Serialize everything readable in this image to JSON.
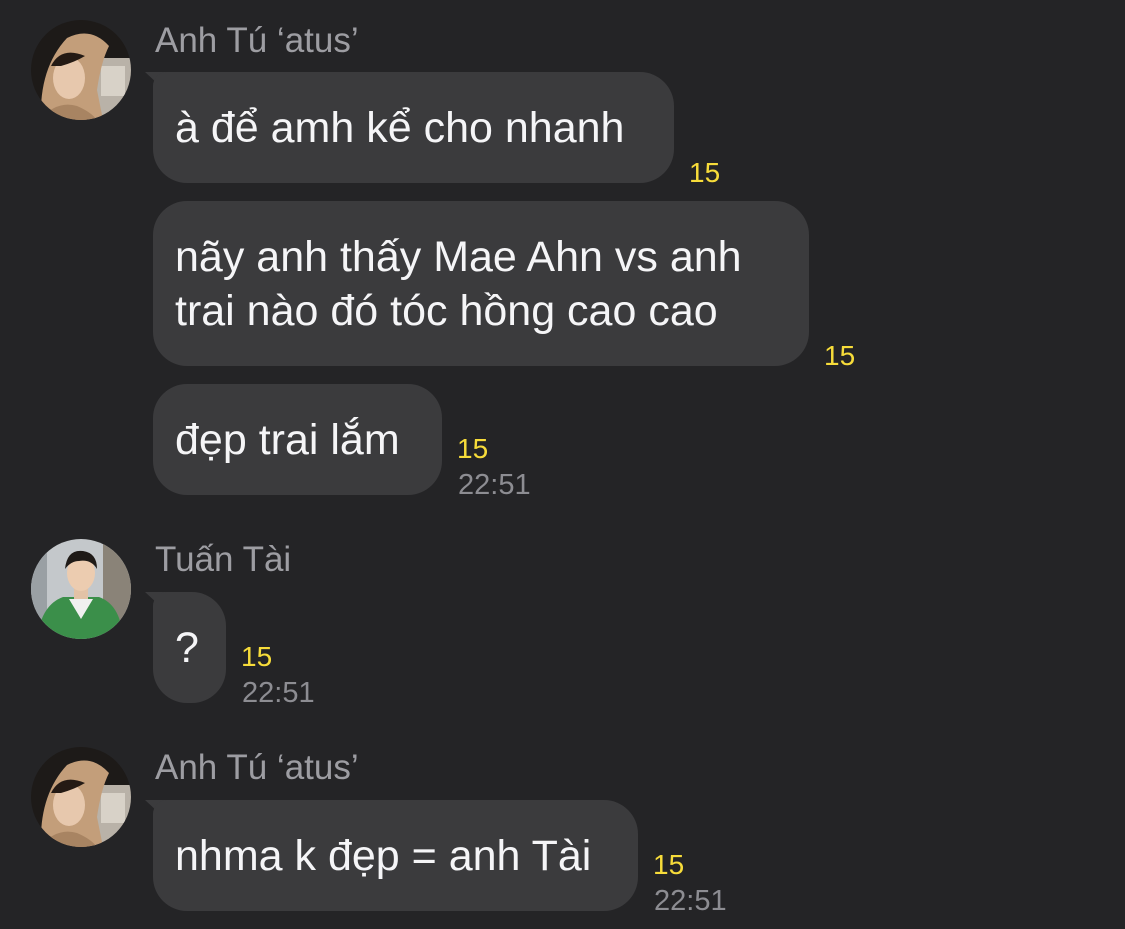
{
  "groups": [
    {
      "sender": "Anh Tú ‘atus’",
      "avatar": "avatar-anh-tu",
      "messages": [
        {
          "text": "à để amh kể cho nhanh",
          "reaction": "15"
        },
        {
          "lines": [
            "nãy anh thấy Mae Ahn vs anh",
            "trai nào đó tóc hồng cao cao"
          ],
          "reaction": "15"
        },
        {
          "text": "đẹp trai lắm",
          "reaction": "15",
          "time": "22:51"
        }
      ]
    },
    {
      "sender": "Tuấn Tài",
      "avatar": "avatar-tuan-tai",
      "messages": [
        {
          "text": "?",
          "reaction": "15",
          "time": "22:51"
        }
      ]
    },
    {
      "sender": "Anh Tú ‘atus’",
      "avatar": "avatar-anh-tu",
      "messages": [
        {
          "text": "nhma k đẹp = anh Tài",
          "reaction": "15",
          "time": "22:51"
        }
      ]
    }
  ],
  "colors": {
    "background": "#242426",
    "bubble": "#3b3b3d",
    "reaction": "#f7dc3a",
    "meta": "#8d8d92"
  }
}
